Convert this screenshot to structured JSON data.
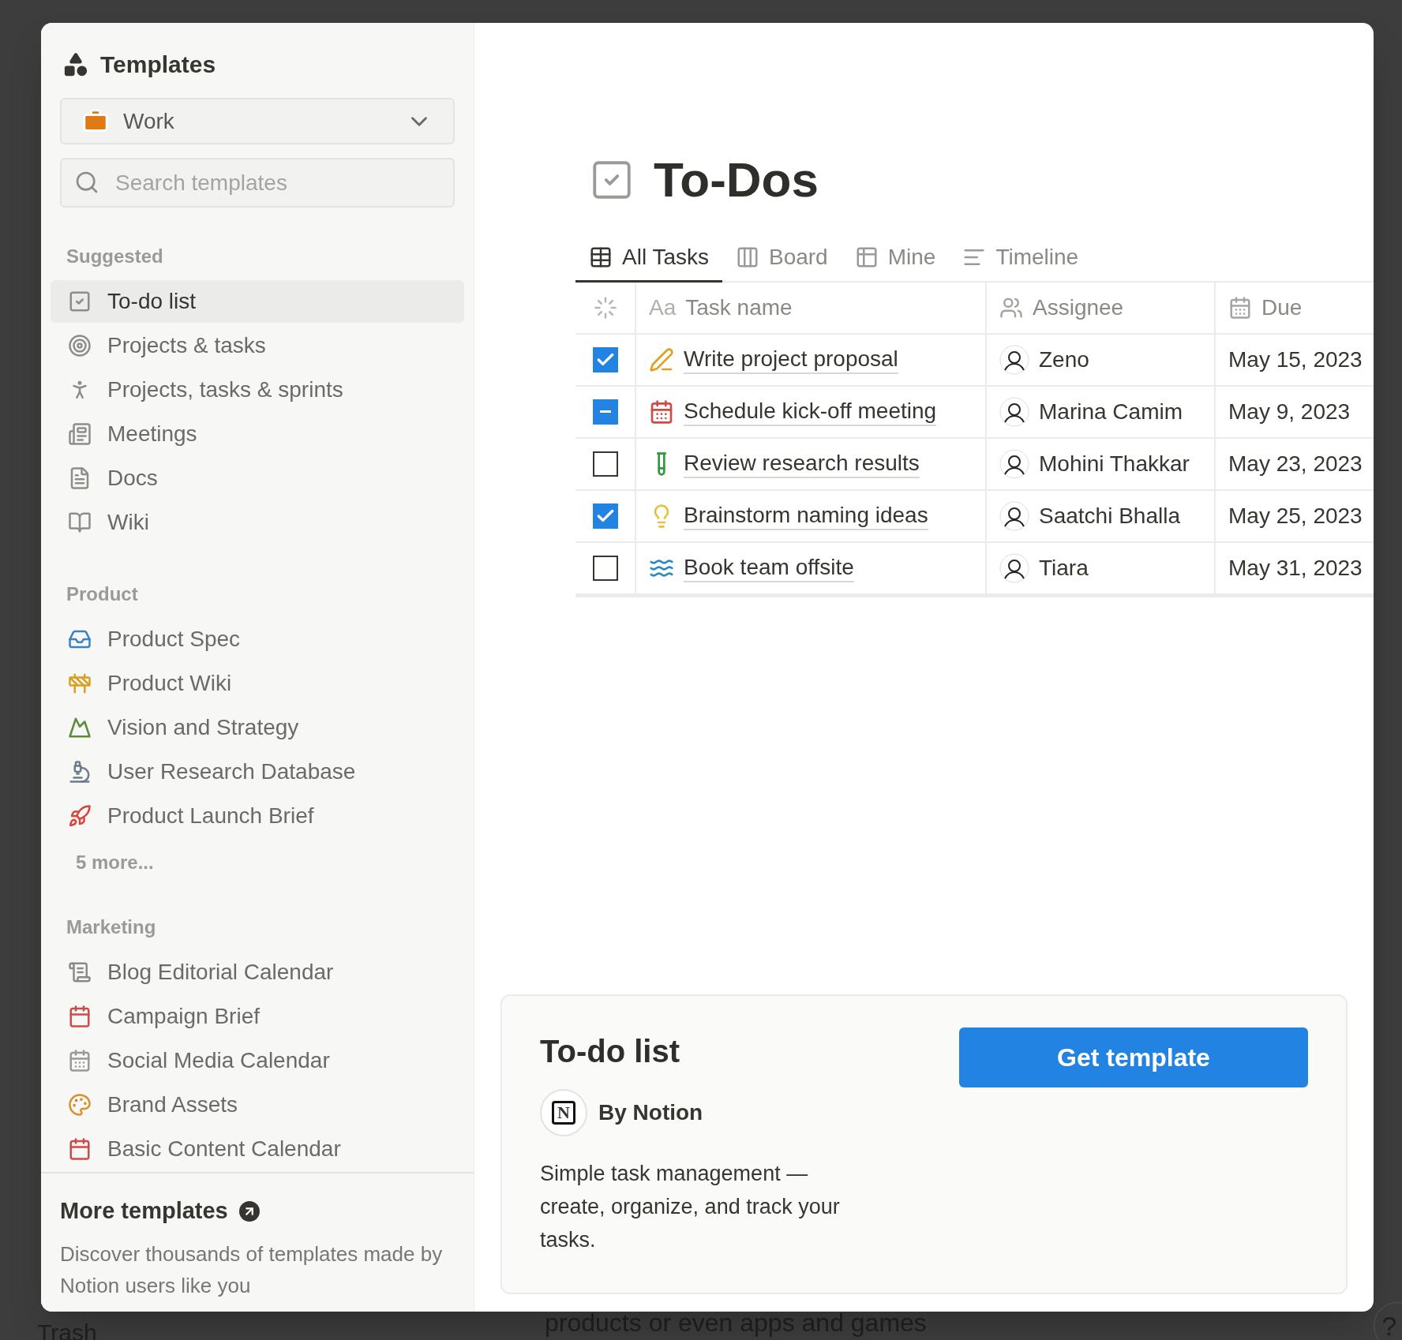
{
  "background": {
    "trash": "Trash",
    "page_text": "products or even apps and games",
    "help": "?"
  },
  "sidebar": {
    "title": "Templates",
    "category": {
      "value": "Work"
    },
    "search": {
      "placeholder": "Search templates"
    },
    "sections": [
      {
        "heading": "Suggested",
        "items": [
          {
            "label": "To-do list",
            "selected": true
          },
          {
            "label": "Projects & tasks",
            "selected": false
          },
          {
            "label": "Projects, tasks & sprints",
            "selected": false
          },
          {
            "label": "Meetings",
            "selected": false
          },
          {
            "label": "Docs",
            "selected": false
          },
          {
            "label": "Wiki",
            "selected": false
          }
        ]
      },
      {
        "heading": "Product",
        "items": [
          {
            "label": "Product Spec",
            "selected": false
          },
          {
            "label": "Product Wiki",
            "selected": false
          },
          {
            "label": "Vision and Strategy",
            "selected": false
          },
          {
            "label": "User Research Database",
            "selected": false
          },
          {
            "label": "Product Launch Brief",
            "selected": false
          }
        ],
        "more": "5 more..."
      },
      {
        "heading": "Marketing",
        "items": [
          {
            "label": "Blog Editorial Calendar",
            "selected": false
          },
          {
            "label": "Campaign Brief",
            "selected": false
          },
          {
            "label": "Social Media Calendar",
            "selected": false
          },
          {
            "label": "Brand Assets",
            "selected": false
          },
          {
            "label": "Basic Content Calendar",
            "selected": false
          }
        ]
      }
    ],
    "footer": {
      "title": "More templates",
      "text": "Discover thousands of templates made by Notion users like you"
    }
  },
  "preview": {
    "title": "To-Dos",
    "tabs": [
      {
        "label": "All Tasks",
        "selected": true
      },
      {
        "label": "Board",
        "selected": false
      },
      {
        "label": "Mine",
        "selected": false
      },
      {
        "label": "Timeline",
        "selected": false
      }
    ],
    "table": {
      "columns": [
        {
          "label": "Task name",
          "prefix": "Aa"
        },
        {
          "label": "Assignee"
        },
        {
          "label": "Due"
        }
      ],
      "rows": [
        {
          "checked": true,
          "task": "Write project proposal",
          "assignee": "Zeno",
          "due": "May 15, 2023"
        },
        {
          "checked": true,
          "mixed": true,
          "task": "Schedule kick-off meeting",
          "assignee": "Marina Camim",
          "due": "May 9, 2023"
        },
        {
          "checked": false,
          "task": "Review research results",
          "assignee": "Mohini Thakkar",
          "due": "May 23, 2023"
        },
        {
          "checked": true,
          "task": "Brainstorm naming ideas",
          "assignee": "Saatchi Bhalla",
          "due": "May 25, 2023"
        },
        {
          "checked": false,
          "task": "Book team offsite",
          "assignee": "Tiara",
          "due": "May 31, 2023"
        }
      ]
    }
  },
  "card": {
    "title": "To-do list",
    "logo_letter": "N",
    "author": "By Notion",
    "description": "Simple task management — create, organize, and track your tasks.",
    "button": "Get template"
  }
}
